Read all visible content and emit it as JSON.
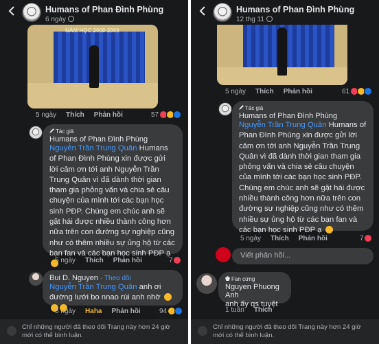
{
  "left": {
    "page_name": "Humans of Phan Đình Phùng",
    "post_time": "6 ngày",
    "photo_banner": "NĂM HỌC 2008-2009",
    "photo_comment": {
      "time": "5 ngày",
      "like": "Thích",
      "reply": "Phản hồi",
      "reactions": "57"
    },
    "author_comment": {
      "badge": "Tác giả",
      "author": "Humans of Phan Đình Phùng",
      "mention": "Nguyễn Trần Trung Quân",
      "text": " Humans of Phan Đình Phùng xin được gửi lời cảm ơn tới anh Nguyễn Trần Trung Quân vì đã dành thời gian tham gia phỏng vấn và chia sẻ câu chuyện của mình tới các bạn học sinh PĐP. Chúng em chúc anh sẽ gặt hái được nhiều thành công hơn nữa trên con đường sự nghiệp cũng như có thêm nhiều sự ủng hộ từ các bạn fan và các bạn học sinh PĐP ạ",
      "time": "5 ngày",
      "like": "Thích",
      "reply": "Phản hồi",
      "reactions": "7"
    },
    "user_comment": {
      "author": "Bui D. Nguyen",
      "follow": "· Theo dõi",
      "mention": "Nguyễn Trần Trung Quân",
      "text": " anh ơi đường lưới bo nnao rùi anh nhờ",
      "time": "5 ngày",
      "like": "Haha",
      "reply": "Phản hồi",
      "reactions": "94"
    },
    "footer_note": "Chỉ những người đã theo dõi Trang này hơn 24 giờ mới có thể bình luận."
  },
  "right": {
    "page_name": "Humans of Phan Đình Phùng",
    "post_time": "12 thg 11",
    "photo_comment": {
      "time": "5 ngày",
      "like": "Thích",
      "reply": "Phản hồi",
      "reactions": "61"
    },
    "author_comment": {
      "badge": "Tác giả",
      "author": "Humans of Phan Đình Phùng",
      "mention": "Nguyễn Trần Trung Quân",
      "text": " Humans of Phan Đình Phùng xin được gửi lời cảm ơn tới anh Nguyễn Trần Trung Quân vì đã dành thời gian tham gia phỏng vấn và chia sẻ câu chuyện của mình tới các bạn học sinh PĐP. Chúng em chúc anh sẽ gặt hái được nhiều thành công hơn nữa trên con đường sự nghiệp cũng như có thêm nhiều sự ủng hộ từ các bạn fan và các bạn học sinh PĐP ạ",
      "time": "5 ngày",
      "like": "Thích",
      "reply": "Phản hồi",
      "reactions": "7"
    },
    "composer_placeholder": "Viết phản hồi...",
    "fan_comment": {
      "badge": "Fan cứng",
      "author": "Nguyen Phuong Anh",
      "text": "anh ấy qs tuyệt",
      "time": "1 tuần",
      "like": "Thích"
    },
    "footer_note": "Chỉ những người đã theo dõi Trang này hơn 24 giờ mới có thể bình luận."
  },
  "colors": {
    "background": "#18191a",
    "bubble": "#3a3b3c",
    "mention": "#4599ff",
    "heart": "#f33e58",
    "haha": "#f7b928"
  }
}
